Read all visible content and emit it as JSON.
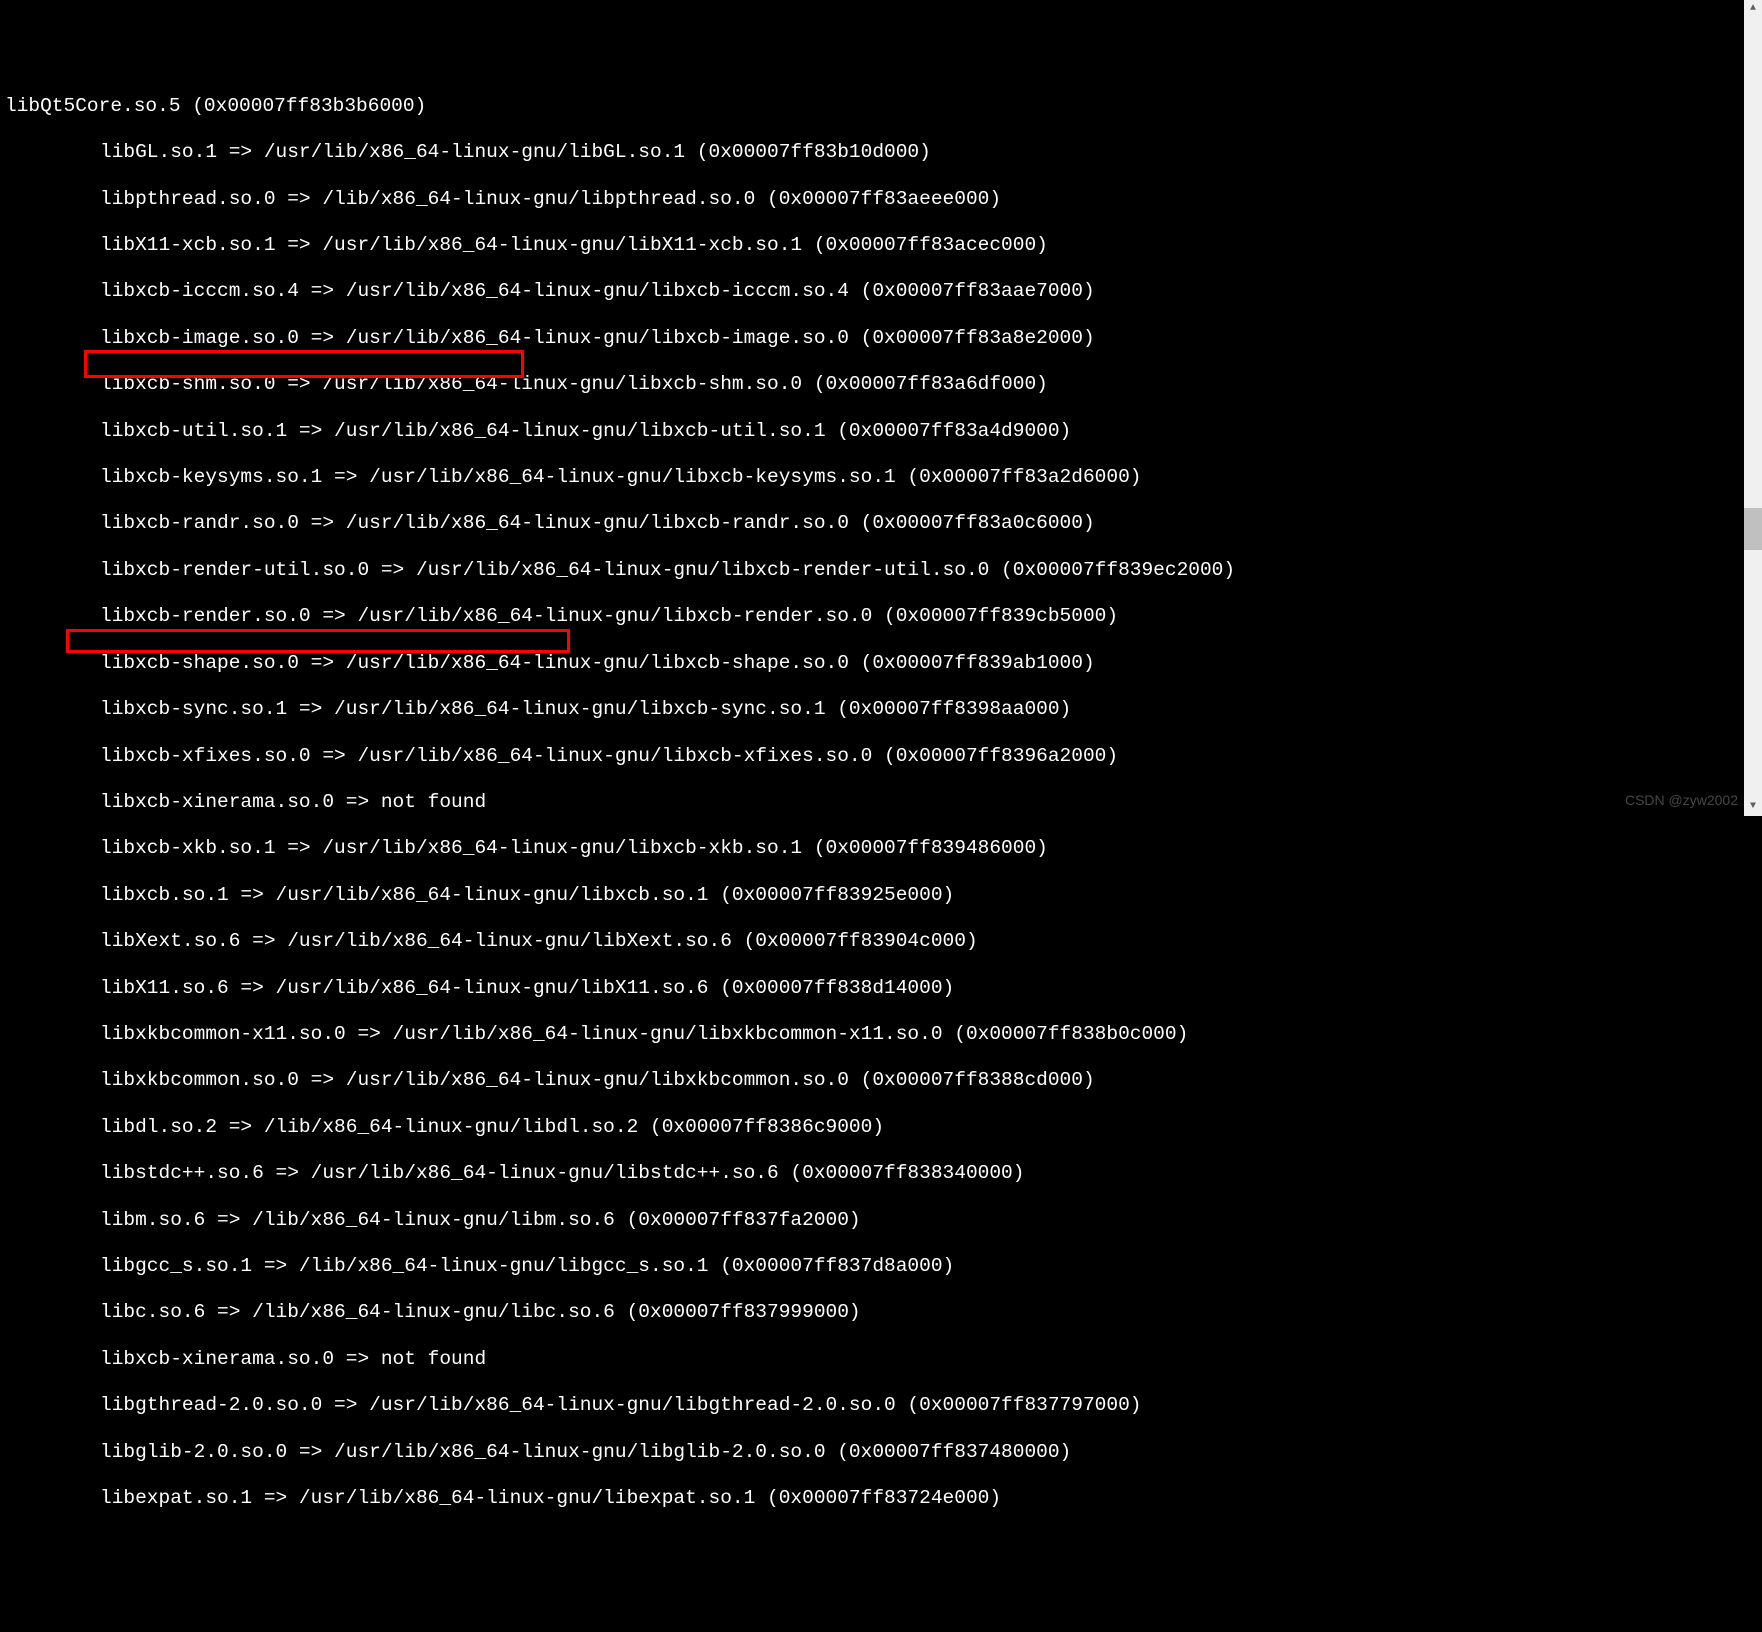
{
  "lines": [
    "libQt5Core.so.5 (0x00007ff83b3b6000)",
    "libGL.so.1 => /usr/lib/x86_64-linux-gnu/libGL.so.1 (0x00007ff83b10d000)",
    "libpthread.so.0 => /lib/x86_64-linux-gnu/libpthread.so.0 (0x00007ff83aeee000)",
    "libX11-xcb.so.1 => /usr/lib/x86_64-linux-gnu/libX11-xcb.so.1 (0x00007ff83acec000)",
    "libxcb-icccm.so.4 => /usr/lib/x86_64-linux-gnu/libxcb-icccm.so.4 (0x00007ff83aae7000)",
    "libxcb-image.so.0 => /usr/lib/x86_64-linux-gnu/libxcb-image.so.0 (0x00007ff83a8e2000)",
    "libxcb-shm.so.0 => /usr/lib/x86_64-linux-gnu/libxcb-shm.so.0 (0x00007ff83a6df000)",
    "libxcb-util.so.1 => /usr/lib/x86_64-linux-gnu/libxcb-util.so.1 (0x00007ff83a4d9000)",
    "libxcb-keysyms.so.1 => /usr/lib/x86_64-linux-gnu/libxcb-keysyms.so.1 (0x00007ff83a2d6000)",
    "libxcb-randr.so.0 => /usr/lib/x86_64-linux-gnu/libxcb-randr.so.0 (0x00007ff83a0c6000)",
    "libxcb-render-util.so.0 => /usr/lib/x86_64-linux-gnu/libxcb-render-util.so.0 (0x00007ff839ec2000)",
    "libxcb-render.so.0 => /usr/lib/x86_64-linux-gnu/libxcb-render.so.0 (0x00007ff839cb5000)",
    "libxcb-shape.so.0 => /usr/lib/x86_64-linux-gnu/libxcb-shape.so.0 (0x00007ff839ab1000)",
    "libxcb-sync.so.1 => /usr/lib/x86_64-linux-gnu/libxcb-sync.so.1 (0x00007ff8398aa000)",
    "libxcb-xfixes.so.0 => /usr/lib/x86_64-linux-gnu/libxcb-xfixes.so.0 (0x00007ff8396a2000)",
    "libxcb-xinerama.so.0 => not found",
    "libxcb-xkb.so.1 => /usr/lib/x86_64-linux-gnu/libxcb-xkb.so.1 (0x00007ff839486000)",
    "libxcb.so.1 => /usr/lib/x86_64-linux-gnu/libxcb.so.1 (0x00007ff83925e000)",
    "libXext.so.6 => /usr/lib/x86_64-linux-gnu/libXext.so.6 (0x00007ff83904c000)",
    "libX11.so.6 => /usr/lib/x86_64-linux-gnu/libX11.so.6 (0x00007ff838d14000)",
    "libxkbcommon-x11.so.0 => /usr/lib/x86_64-linux-gnu/libxkbcommon-x11.so.0 (0x00007ff838b0c000)",
    "libxkbcommon.so.0 => /usr/lib/x86_64-linux-gnu/libxkbcommon.so.0 (0x00007ff8388cd000)",
    "libdl.so.2 => /lib/x86_64-linux-gnu/libdl.so.2 (0x00007ff8386c9000)",
    "libstdc++.so.6 => /usr/lib/x86_64-linux-gnu/libstdc++.so.6 (0x00007ff838340000)",
    "libm.so.6 => /lib/x86_64-linux-gnu/libm.so.6 (0x00007ff837fa2000)",
    "libgcc_s.so.1 => /lib/x86_64-linux-gnu/libgcc_s.so.1 (0x00007ff837d8a000)",
    "libc.so.6 => /lib/x86_64-linux-gnu/libc.so.6 (0x00007ff837999000)",
    "libxcb-xinerama.so.0 => not found",
    "libgthread-2.0.so.0 => /usr/lib/x86_64-linux-gnu/libgthread-2.0.so.0 (0x00007ff837797000)",
    "libglib-2.0.so.0 => /usr/lib/x86_64-linux-gnu/libglib-2.0.so.0 (0x00007ff837480000)",
    "libexpat.so.1 => /usr/lib/x86_64-linux-gnu/libexpat.so.1 (0x00007ff83724e000)"
  ],
  "highlighted_indices": [
    15,
    27
  ],
  "watermark": "CSDN @zyw2002",
  "scroll": {
    "up_glyph": "▲",
    "down_glyph": "▼"
  }
}
